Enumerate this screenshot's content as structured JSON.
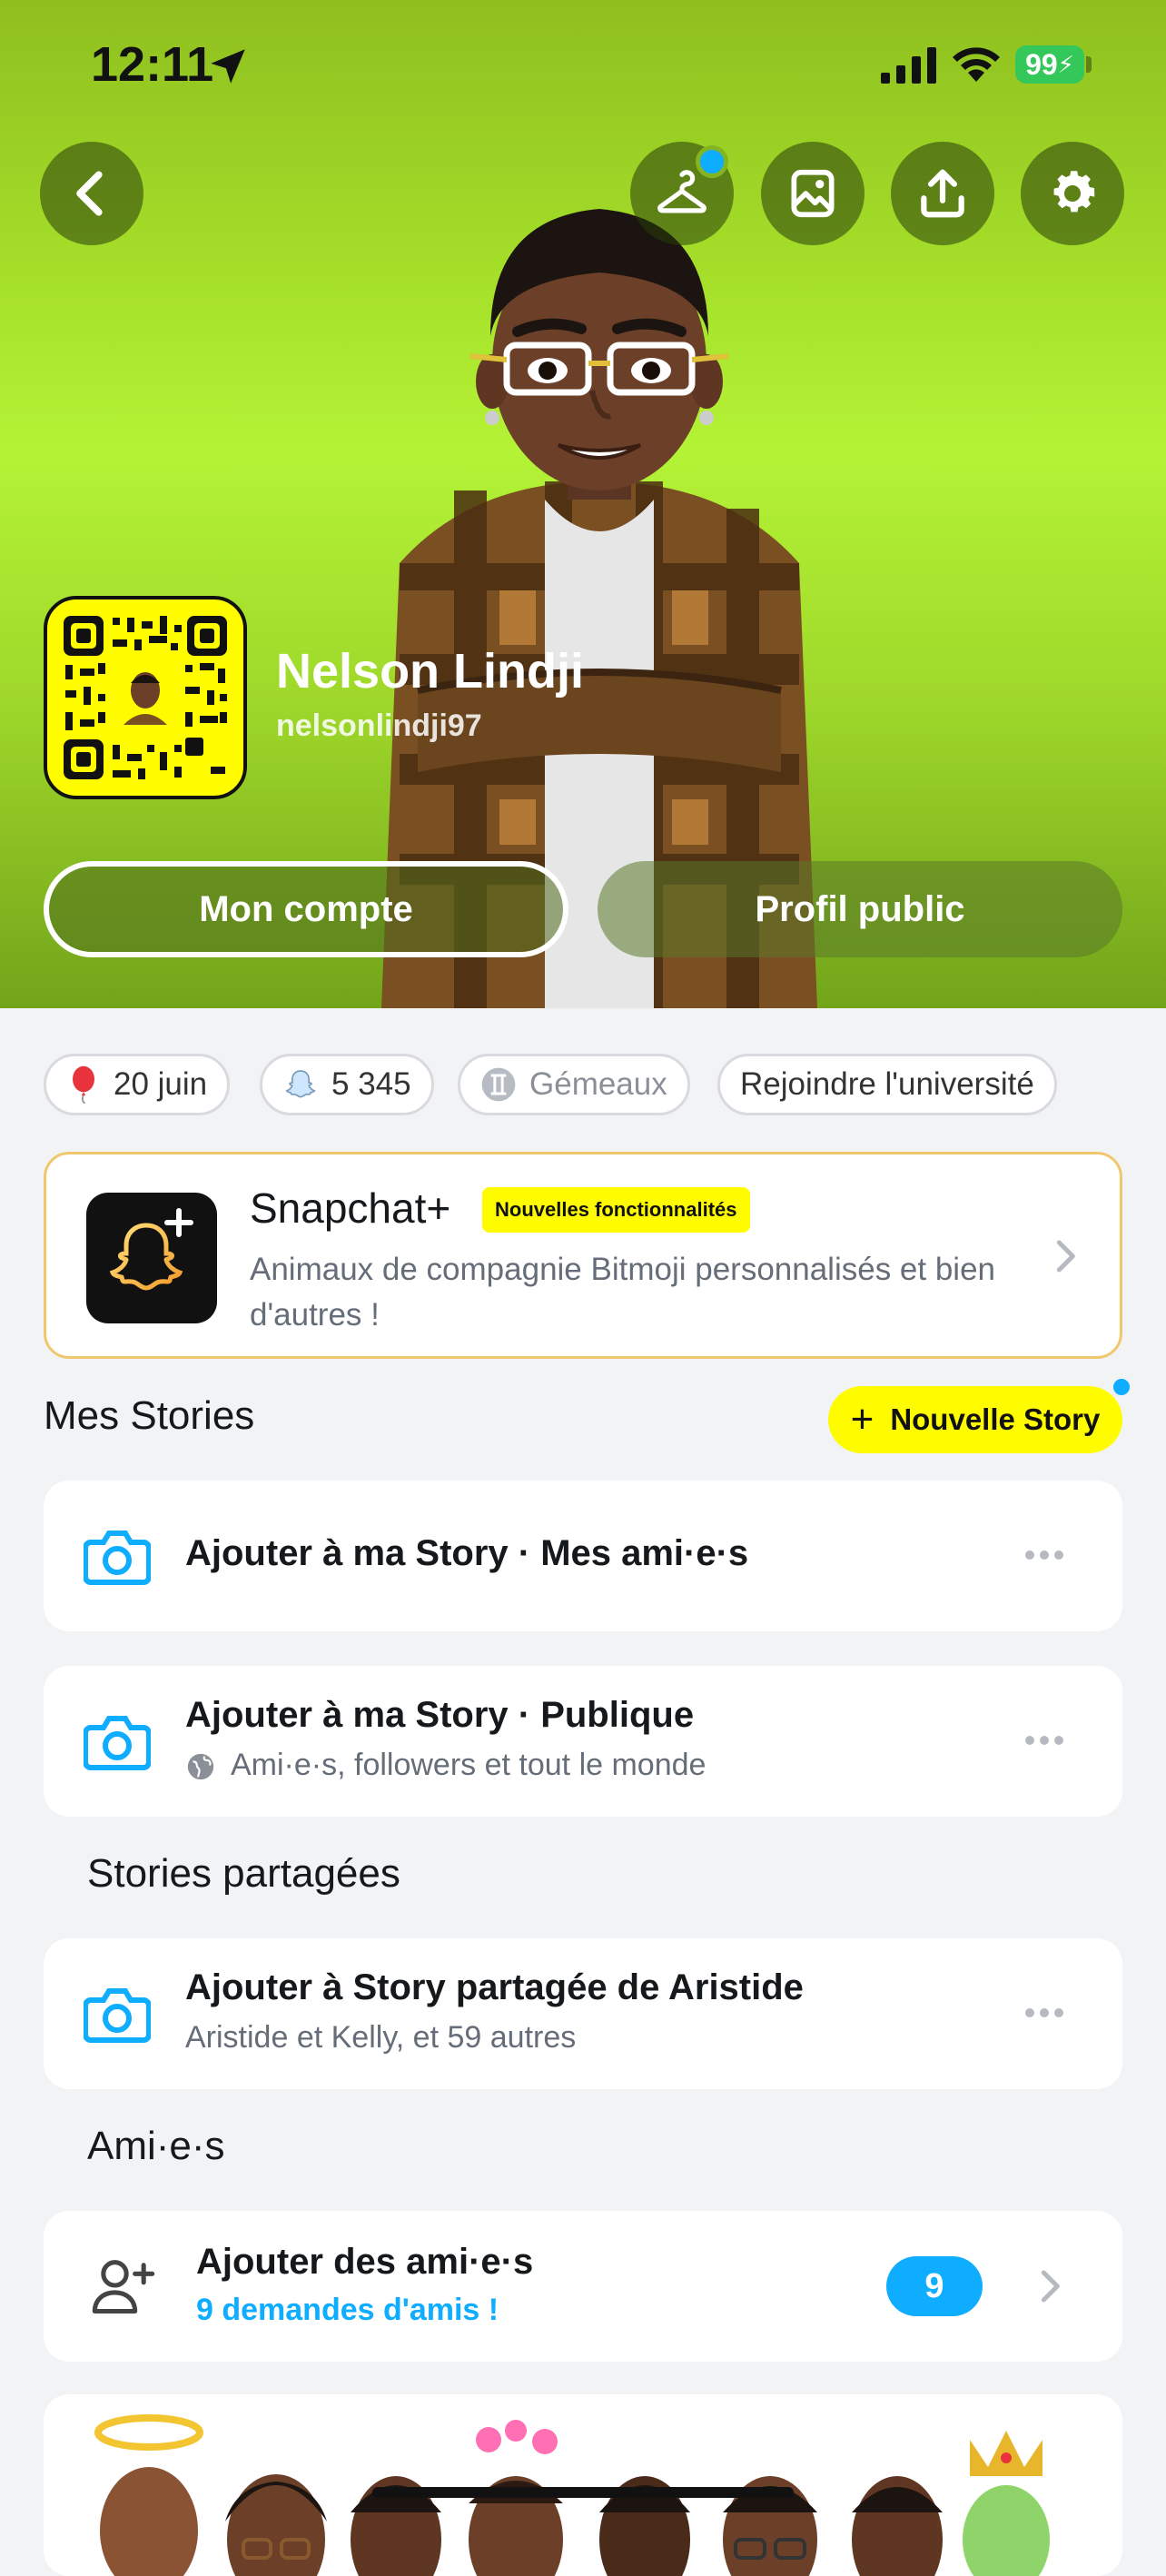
{
  "status_bar": {
    "time": "12:11",
    "battery": "99"
  },
  "profile": {
    "display_name": "Nelson Lindji",
    "username": "nelsonlindji97",
    "buttons": {
      "account": "Mon compte",
      "public": "Profil public"
    }
  },
  "chips": {
    "birthday": "20 juin",
    "score": "5 345",
    "zodiac": "Gémeaux",
    "university": "Rejoindre l'université"
  },
  "snapchat_plus": {
    "title": "Snapchat+",
    "badge": "Nouvelles fonctionnalités",
    "description": "Animaux de compagnie Bitmoji personnalisés et bien d'autres !"
  },
  "my_stories": {
    "title": "Mes Stories",
    "new_story_label": "Nouvelle Story",
    "items": [
      {
        "title": "Ajouter à ma Story · Mes ami·e·s",
        "subtitle": ""
      },
      {
        "title": "Ajouter à ma Story · Publique",
        "subtitle": "Ami·e·s, followers et tout le monde"
      }
    ]
  },
  "shared_stories": {
    "title": "Stories partagées",
    "items": [
      {
        "title": "Ajouter à Story partagée de Aristide",
        "subtitle": "Aristide et Kelly, et 59 autres"
      }
    ]
  },
  "friends": {
    "title": "Ami·e·s",
    "add_title": "Ajouter des ami·e·s",
    "add_subtitle": "9 demandes d'amis !",
    "count": "9"
  },
  "colors": {
    "accent_blue": "#0fadff",
    "snap_yellow": "#fffc00",
    "hero_green": "#b4f336"
  },
  "icons": {
    "back": "chevron-left-icon",
    "hanger": "hanger-icon",
    "photo": "photo-icon",
    "share": "share-icon",
    "settings": "gear-icon"
  }
}
